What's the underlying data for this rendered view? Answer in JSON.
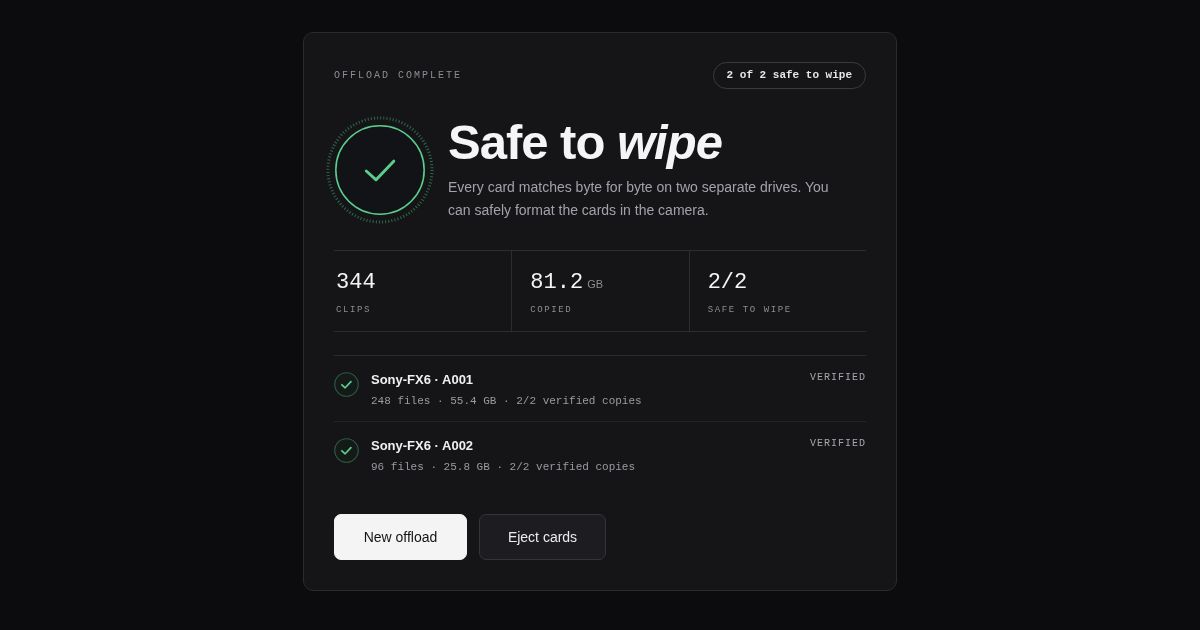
{
  "header": {
    "eyebrow": "OFFLOAD COMPLETE",
    "badge": "2 of 2 safe to wipe"
  },
  "hero": {
    "title": "Safe to *wipe*",
    "description": "Every card matches byte for byte on two separate drives. You can safely format the cards in the camera."
  },
  "stats": [
    {
      "value": "344",
      "label": "CLIPS"
    },
    {
      "value": "81.2",
      "unit": "GB",
      "label": "COPIED"
    },
    {
      "value": "2/2",
      "label": "SAFE TO WIPE"
    }
  ],
  "cards": [
    {
      "name": "Sony-FX6 · A001",
      "meta": "248 files · 55.4 GB · 2/2 verified copies",
      "status": "VERIFIED",
      "verified": true
    },
    {
      "name": "Sony-FX6 · A002",
      "meta": "96 files · 25.8 GB · 2/2 verified copies",
      "status": "VERIFIED",
      "verified": true
    }
  ],
  "buttons": [
    {
      "label": "New offload",
      "kind": "primary"
    },
    {
      "label": "Eject cards",
      "kind": "secondary"
    }
  ]
}
